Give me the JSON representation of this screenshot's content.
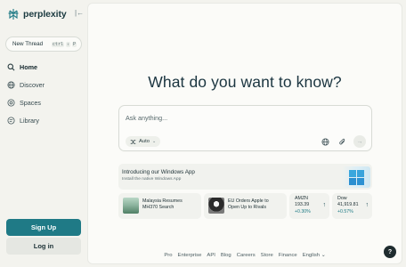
{
  "brand": {
    "name": "perplexity",
    "accent": "#1f7a86"
  },
  "sidebar": {
    "new_thread": {
      "label": "New Thread",
      "shortcut_keys": [
        "ctrl",
        "⇧",
        "P"
      ]
    },
    "items": [
      {
        "label": "Home",
        "icon": "search-icon",
        "active": true
      },
      {
        "label": "Discover",
        "icon": "globe-icon",
        "active": false
      },
      {
        "label": "Spaces",
        "icon": "spaces-icon",
        "active": false
      },
      {
        "label": "Library",
        "icon": "library-icon",
        "active": false
      }
    ],
    "signup_label": "Sign Up",
    "login_label": "Log in"
  },
  "main": {
    "heading": "What do you want to know?",
    "search": {
      "placeholder": "Ask anything...",
      "model_label": "Auto"
    },
    "banner": {
      "title": "Introducing our Windows App",
      "subtitle": "Install the native Windows App"
    },
    "news": [
      {
        "title": "Malaysia Resumes MH370 Search"
      },
      {
        "title": "EU Orders Apple to Open Up to Rivals"
      }
    ],
    "stocks": [
      {
        "name": "AMZN",
        "price": "193.39",
        "change": "+0.30%"
      },
      {
        "name": "Dow",
        "price": "41,919.81",
        "change": "+0.57%"
      }
    ]
  },
  "footer": {
    "links": [
      "Pro",
      "Enterprise",
      "API",
      "Blog",
      "Careers",
      "Store",
      "Finance",
      "English"
    ]
  },
  "help": {
    "label": "?"
  }
}
